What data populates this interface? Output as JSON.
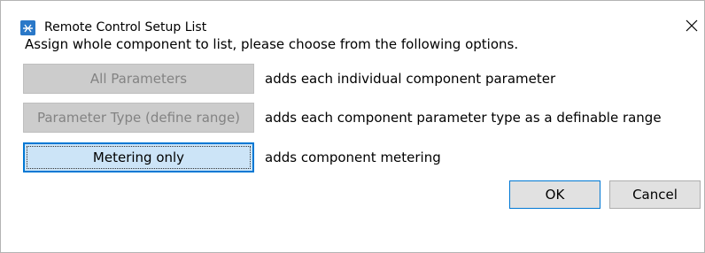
{
  "window": {
    "title": "Remote Control Setup List",
    "close_symbol": "X",
    "app_icon": "remote-control-app-icon"
  },
  "dialog": {
    "instruction": "Assign whole component to list, please choose from the following options.",
    "options": [
      {
        "label": "All Parameters",
        "description": "adds each individual component parameter",
        "state": "disabled"
      },
      {
        "label": "Parameter Type (define range)",
        "description": "adds each component parameter type as a definable range",
        "state": "disabled"
      },
      {
        "label": "Metering only",
        "description": "adds component metering",
        "state": "focused"
      }
    ],
    "ok_label": "OK",
    "cancel_label": "Cancel"
  },
  "colors": {
    "accent": "#0078d4",
    "focused_button_bg": "#cce4f7",
    "disabled_button_bg": "#cccccc",
    "disabled_text": "#838383",
    "button_bg": "#e1e1e1",
    "app_icon_bg": "#2a78c8"
  }
}
